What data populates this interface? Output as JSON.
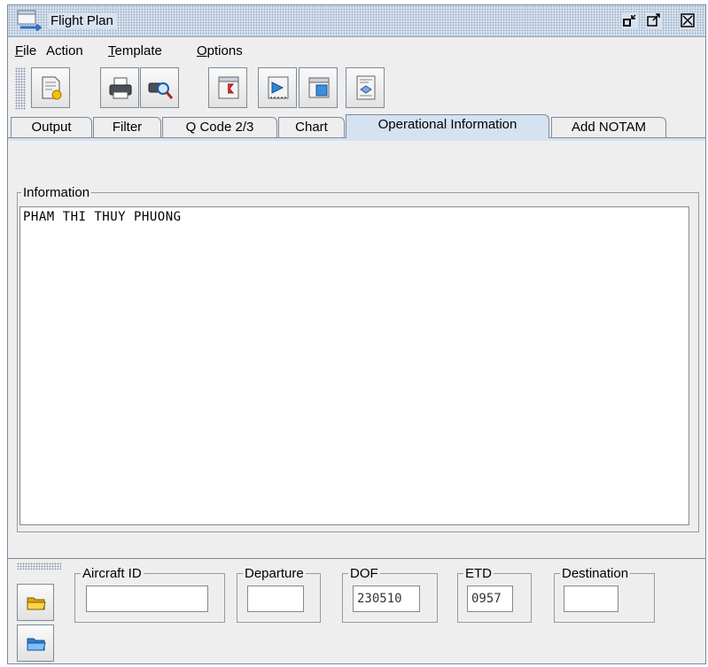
{
  "window": {
    "title": "Flight Plan",
    "icons": [
      "app-icon",
      "restore-icon",
      "maximize-icon",
      "close-icon"
    ]
  },
  "menu": {
    "items": [
      {
        "label": "File",
        "mnemonic": "F"
      },
      {
        "label": "Action",
        "mnemonic": ""
      },
      {
        "label": "Template",
        "mnemonic": "T"
      },
      {
        "label": "Options",
        "mnemonic": "O"
      }
    ]
  },
  "toolbar": {
    "buttons": [
      "new-document-icon",
      "print-icon",
      "print-preview-icon",
      "template-icon",
      "send-icon",
      "window-icon",
      "report-icon"
    ]
  },
  "tabs": [
    {
      "label": "Output"
    },
    {
      "label": "Filter"
    },
    {
      "label": "Q Code 2/3"
    },
    {
      "label": "Chart"
    },
    {
      "label": "Operational Information",
      "active": true
    },
    {
      "label": "Add NOTAM"
    }
  ],
  "info": {
    "legend": "Information",
    "text": "PHAM THI THUY PHUONG"
  },
  "fields": {
    "aircraft_id": {
      "label": "Aircraft ID",
      "value": ""
    },
    "departure": {
      "label": "Departure",
      "value": ""
    },
    "dof": {
      "label": "DOF",
      "value": "230510"
    },
    "etd": {
      "label": "ETD",
      "value": "0957"
    },
    "destination": {
      "label": "Destination",
      "value": ""
    }
  },
  "side_buttons": [
    "open-folder-icon",
    "save-folder-icon"
  ],
  "colors": {
    "active_tab": "#d4e2f2",
    "titlebar": "#d9e3ef",
    "border": "#7d8a99"
  }
}
